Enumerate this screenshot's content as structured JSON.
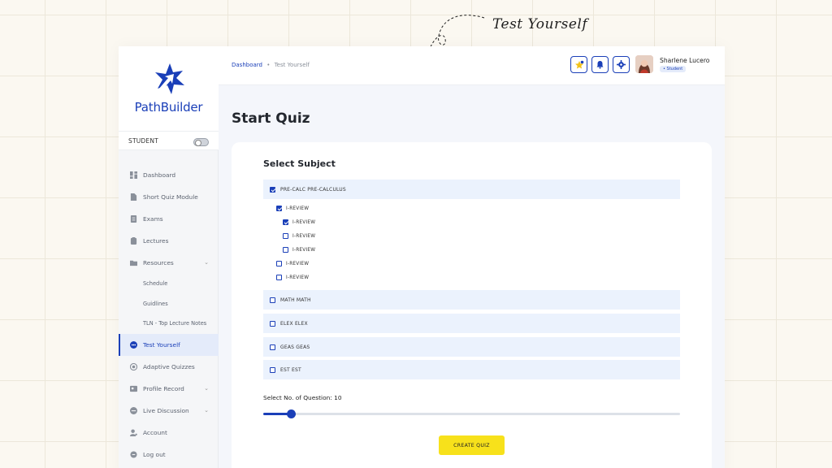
{
  "annotation": {
    "label": "Test Yourself"
  },
  "brand": {
    "name": "PathBuilder",
    "color": "#1a3fb8"
  },
  "role_switch": {
    "label": "STUDENT",
    "enabled": false
  },
  "sidebar": {
    "items": [
      {
        "label": "Dashboard",
        "icon": "dashboard-grid-icon"
      },
      {
        "label": "Short Quiz Module",
        "icon": "document-icon"
      },
      {
        "label": "Exams",
        "icon": "exam-sheet-icon"
      },
      {
        "label": "Lectures",
        "icon": "lectures-icon"
      },
      {
        "label": "Resources",
        "icon": "folder-icon",
        "expanded": true,
        "children": [
          "Schedule",
          "Guidlines",
          "TLN - Top Lecture Notes"
        ]
      },
      {
        "label": "Test Yourself",
        "icon": "test-yourself-icon",
        "active": true
      },
      {
        "label": "Adaptive Quizzes",
        "icon": "adaptive-quiz-icon"
      },
      {
        "label": "Profile Record",
        "icon": "profile-record-icon",
        "has_submenu": true
      },
      {
        "label": "Live Discussion",
        "icon": "live-discussion-icon",
        "has_submenu": true
      },
      {
        "label": "Account",
        "icon": "account-icon"
      },
      {
        "label": "Log out",
        "icon": "logout-icon"
      }
    ]
  },
  "header": {
    "breadcrumb": {
      "root": "Dashboard",
      "separator": "•",
      "current": "Test Yourself"
    },
    "icons": [
      "star-badge-icon",
      "bell-icon",
      "gear-icon"
    ],
    "user": {
      "name": "Sharlene Lucero",
      "role": "• Student"
    }
  },
  "main": {
    "title": "Start Quiz",
    "section_title": "Select Subject",
    "subjects": [
      {
        "label": "PRE-CALC PRE-CALCULUS",
        "checked": true
      },
      {
        "label": "MATH MATH",
        "checked": false
      },
      {
        "label": "ELEX ELEX",
        "checked": false
      },
      {
        "label": "GEAS GEAS",
        "checked": false
      },
      {
        "label": "EST EST",
        "checked": false
      }
    ],
    "precalc_children": [
      {
        "label": "I-REVIEW",
        "checked": true,
        "level": 1
      },
      {
        "label": "I-REVIEW",
        "checked": true,
        "level": 2
      },
      {
        "label": "I-REVIEW",
        "checked": false,
        "level": 2
      },
      {
        "label": "I-REVIEW",
        "checked": false,
        "level": 2
      },
      {
        "label": "I-REVIEW",
        "checked": false,
        "level": 1
      },
      {
        "label": "I-REVIEW",
        "checked": false,
        "level": 1
      }
    ],
    "question_count": {
      "label": "Select No. of Question: 10",
      "value": 10,
      "fraction": 0.066
    },
    "create_button": "CREATE QUIZ"
  },
  "colors": {
    "accent": "#1a3fb8",
    "button_yellow": "#f7e11b",
    "subject_row_bg": "#ebf2fd"
  }
}
